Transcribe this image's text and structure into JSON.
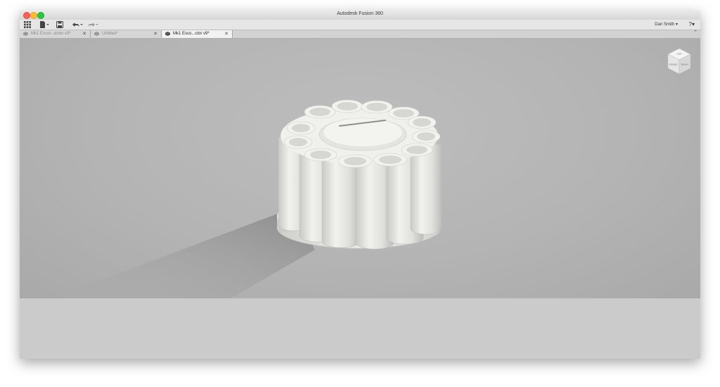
{
  "window": {
    "title": "Autodesk Fusion 360"
  },
  "toolbar": {
    "grid_icon": "app-grid-icon",
    "file_icon": "file-icon",
    "save_icon": "save-icon",
    "undo_icon": "undo-icon",
    "redo_icon": "redo-icon",
    "user_label": "Dan Smith ▾",
    "help_label": "?▾"
  },
  "tabs": [
    {
      "label": "Mk1 Escor...ector v3*",
      "active": false
    },
    {
      "label": "Untitled*",
      "active": false
    },
    {
      "label": "Mk1 Esco...ctor v9*",
      "active": true
    }
  ],
  "viewcube": {
    "top": "TOP",
    "front": "FRONT",
    "right": "RIGHT"
  },
  "colors": {
    "viewport": "#b6b6b6",
    "model": "#e9e9e6",
    "bottom_panel": "#cbcbcb"
  }
}
